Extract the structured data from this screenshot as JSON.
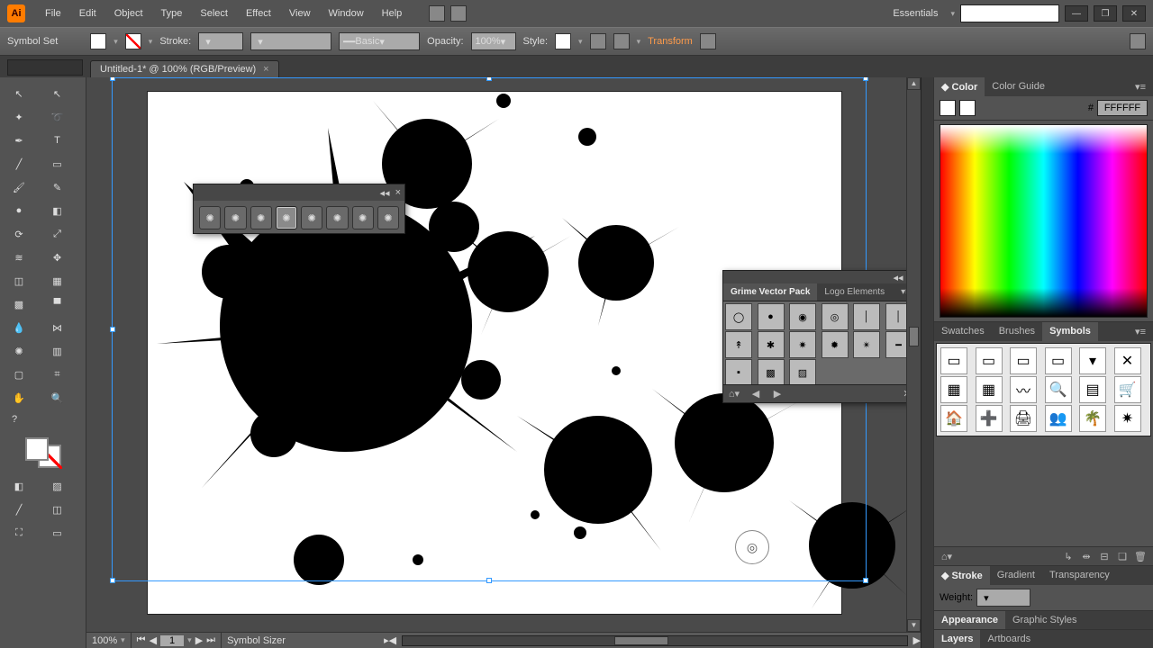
{
  "app": {
    "icon_text": "Ai",
    "workspace": "Essentials"
  },
  "menu": [
    "File",
    "Edit",
    "Object",
    "Type",
    "Select",
    "Effect",
    "View",
    "Window",
    "Help"
  ],
  "window_controls": {
    "min": "—",
    "max": "❐",
    "close": "✕"
  },
  "control_bar": {
    "context": "Symbol Set",
    "stroke_label": "Stroke:",
    "brush_label": "Basic",
    "opacity_label": "Opacity:",
    "opacity_value": "100%",
    "style_label": "Style:",
    "transform_label": "Transform"
  },
  "document": {
    "tab_title": "Untitled-1* @ 100% (RGB/Preview)"
  },
  "toolbox": {
    "tools": [
      "selection",
      "direct-selection",
      "magic-wand",
      "lasso",
      "pen",
      "type",
      "line-segment",
      "rectangle",
      "paintbrush",
      "pencil",
      "blob-brush",
      "eraser",
      "rotate",
      "scale",
      "width",
      "free-transform",
      "shape-builder",
      "perspective-grid",
      "mesh",
      "gradient",
      "eyedropper",
      "blend",
      "symbol-sprayer",
      "column-graph",
      "artboard",
      "slice",
      "hand",
      "zoom"
    ],
    "help": "?"
  },
  "floating_tool_panel": {
    "tools": [
      "symbol-sprayer",
      "symbol-shifter",
      "symbol-scruncher",
      "symbol-sizer",
      "symbol-spinner",
      "symbol-stainer",
      "symbol-screener",
      "symbol-styler"
    ],
    "active_index": 3
  },
  "floating_symbols_panel": {
    "tabs": [
      "Grime Vector Pack",
      "Logo Elements"
    ],
    "active_tab": 0,
    "footer_icons": [
      "library",
      "prev",
      "next",
      "close"
    ]
  },
  "right": {
    "color_tabs": [
      "Color",
      "Color Guide"
    ],
    "hex_prefix": "#",
    "hex_value": "FFFFFF",
    "mid_tabs": [
      "Swatches",
      "Brushes",
      "Symbols"
    ],
    "mid_active": 2,
    "symbol_glyphs": [
      "▭",
      "▭",
      "▭",
      "▭",
      "▾",
      "✕",
      "▦",
      "▦",
      "〰",
      "🔍",
      "▤",
      "🛒",
      "🏠",
      "➕",
      "🖨",
      "👥",
      "🌴",
      "✷"
    ],
    "footer_icons": [
      "library",
      "link",
      "break",
      "opts",
      "new",
      "trash"
    ],
    "stroke_tabs": [
      "Stroke",
      "Gradient",
      "Transparency"
    ],
    "stroke_weight_label": "Weight:",
    "appearance_tabs": [
      "Appearance",
      "Graphic Styles"
    ],
    "layers_tabs": [
      "Layers",
      "Artboards"
    ]
  },
  "status": {
    "zoom": "100%",
    "page_nav": {
      "first": "⏮",
      "prev": "◀",
      "page": "1",
      "next": "▶",
      "last": "⏭"
    },
    "tool_name": "Symbol Sizer"
  }
}
